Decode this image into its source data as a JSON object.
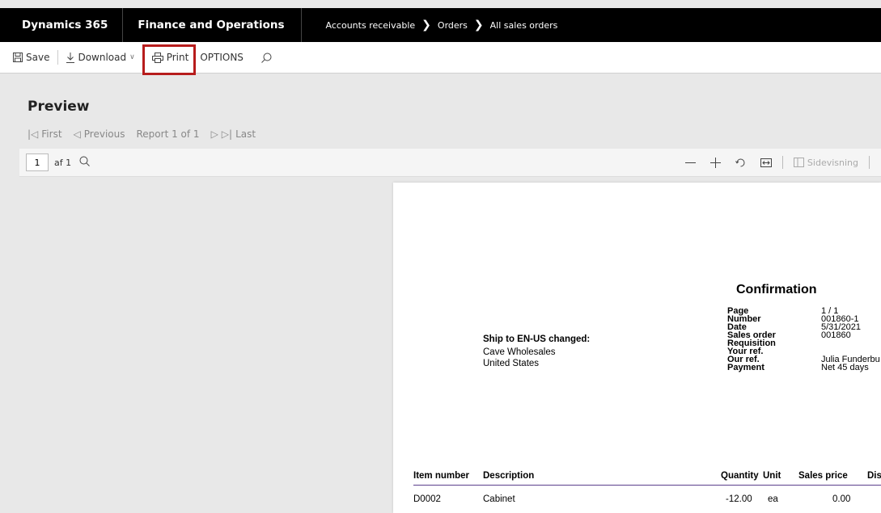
{
  "topbar": {
    "brand": "Dynamics 365",
    "module": "Finance and Operations",
    "breadcrumb": [
      "Accounts receivable",
      "Orders",
      "All sales orders"
    ]
  },
  "toolbar": {
    "save_label": "Save",
    "download_label": "Download",
    "print_label": "Print",
    "options_label": "OPTIONS",
    "highlight_color": "#b71c1c"
  },
  "preview": {
    "title": "Preview",
    "pager": {
      "first": "First",
      "previous": "Previous",
      "report": "Report 1 of 1",
      "last": "Last"
    },
    "viewer": {
      "page_value": "1",
      "of_label": "af 1",
      "side_view": "Sidevisning"
    }
  },
  "document": {
    "ship_to": {
      "title": "Ship to EN-US changed:",
      "lines": [
        "Cave Wholesales",
        "United States"
      ]
    },
    "confirmation": {
      "title": "Confirmation",
      "rows": [
        {
          "label": "Page",
          "value": "1 / 1"
        },
        {
          "label": "Number",
          "value": "001860-1"
        },
        {
          "label": "Date",
          "value": "5/31/2021"
        },
        {
          "label": "Sales order",
          "value": "001860"
        },
        {
          "label": "Requisition",
          "value": ""
        },
        {
          "label": "Your ref.",
          "value": ""
        },
        {
          "label": "Our ref.",
          "value": "Julia Funderbu"
        },
        {
          "label": "Payment",
          "value": "Net 45 days"
        }
      ]
    },
    "items": {
      "headers": {
        "item": "Item number",
        "description": "Description",
        "quantity": "Quantity",
        "unit": "Unit",
        "price": "Sales price",
        "discount": "Disc"
      },
      "rows": [
        {
          "item": "D0002",
          "description": "Cabinet",
          "quantity": "-12.00",
          "unit": "ea",
          "price": "0.00"
        }
      ]
    }
  }
}
